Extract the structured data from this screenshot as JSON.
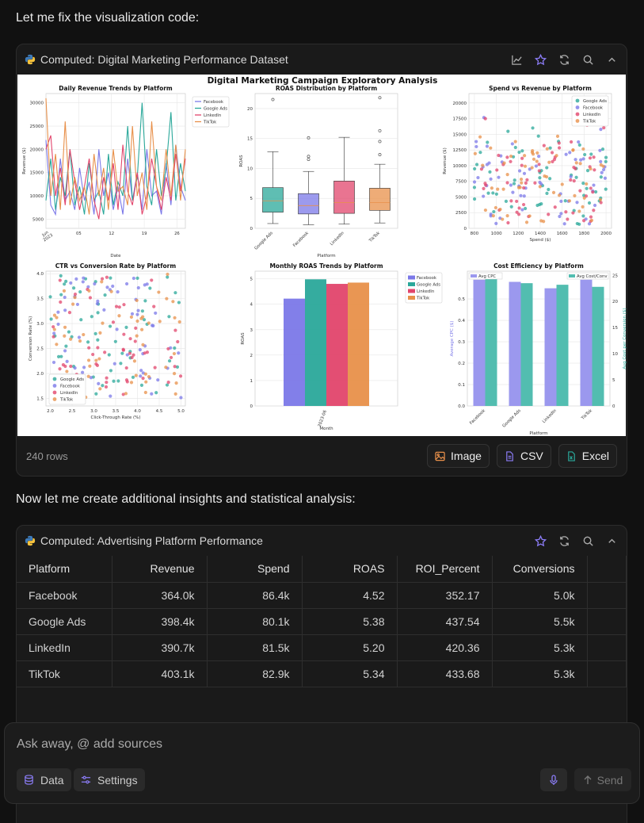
{
  "messages": {
    "first": "Let me fix the visualization code:",
    "second": "Now let me create additional insights and statistical analysis:"
  },
  "card1": {
    "title": "Computed: Digital Marketing Performance Dataset",
    "icons": [
      "line-chart-icon",
      "star-icon",
      "refresh-icon",
      "search-icon",
      "chevron-up-icon"
    ],
    "rows_label": "240 rows",
    "buttons": {
      "image": "Image",
      "csv": "CSV",
      "excel": "Excel"
    }
  },
  "figure": {
    "suptitle": "Digital Marketing Campaign Exploratory Analysis",
    "platforms": [
      "Facebook",
      "Google Ads",
      "LinkedIn",
      "TikTok"
    ],
    "colors": {
      "Facebook": "#7b78e8",
      "Google Ads": "#2aa89a",
      "LinkedIn": "#e2456c",
      "TikTok": "#e8904a"
    }
  },
  "chart_data": [
    {
      "type": "line",
      "title": "Daily Revenue Trends by Platform",
      "xlabel": "Date",
      "ylabel": "Revenue ($)",
      "xticks": [
        "Jun\n2023",
        "05",
        "12",
        "19",
        "26"
      ],
      "yticks": [
        "5000",
        "10000",
        "15000",
        "20000",
        "25000",
        "30000"
      ],
      "ylim": [
        3000,
        32000
      ],
      "legend": [
        "Facebook",
        "Google Ads",
        "LinkedIn",
        "TikTok"
      ],
      "series": [
        {
          "name": "Facebook",
          "values": [
            22000,
            8000,
            6000,
            18000,
            9000,
            11000,
            7000,
            16000,
            9000,
            13000,
            6000,
            20000,
            10000,
            15000,
            7000,
            12000,
            6000,
            18000,
            9000,
            15000,
            7000,
            20000,
            10000,
            11000,
            6000,
            17000,
            8000,
            21000,
            12000,
            9000
          ]
        },
        {
          "name": "Google Ads",
          "values": [
            9000,
            18000,
            7000,
            14000,
            10000,
            20000,
            8000,
            12000,
            6000,
            17000,
            9000,
            11000,
            6000,
            19000,
            8000,
            13000,
            10000,
            25000,
            9000,
            14000,
            30000,
            12000,
            8000,
            20000,
            10000,
            16000,
            28000,
            9000,
            17000,
            11000
          ]
        },
        {
          "name": "LinkedIn",
          "values": [
            20000,
            23000,
            10000,
            16000,
            8000,
            20000,
            13000,
            7000,
            12000,
            18000,
            9000,
            5000,
            14000,
            9000,
            17000,
            7000,
            21000,
            11000,
            8000,
            15000,
            6000,
            10000,
            18000,
            12000,
            7000,
            14000,
            9000,
            19000,
            11000,
            18000
          ]
        },
        {
          "name": "TikTok",
          "values": [
            31000,
            10000,
            19000,
            7000,
            26000,
            8000,
            14000,
            9000,
            12000,
            6000,
            19000,
            10000,
            16000,
            7000,
            20000,
            11000,
            12000,
            8000,
            25000,
            10000,
            15000,
            7000,
            26000,
            12000,
            9000,
            20000,
            10000,
            21000,
            9000,
            20000
          ]
        }
      ]
    },
    {
      "type": "box",
      "title": "ROAS Distribution by Platform",
      "xlabel": "Platform",
      "ylabel": "ROAS",
      "categories": [
        "Google Ads",
        "Facebook",
        "LinkedIn",
        "TikTok"
      ],
      "yticks": [
        "0",
        "5",
        "10",
        "15",
        "20"
      ],
      "ylim": [
        0,
        22.5
      ],
      "boxes": [
        {
          "name": "Google Ads",
          "min": 0.8,
          "q1": 2.7,
          "median": 4.6,
          "q3": 6.8,
          "max": 12.8,
          "outliers": [
            21.5
          ]
        },
        {
          "name": "Facebook",
          "min": 0.6,
          "q1": 2.4,
          "median": 3.8,
          "q3": 5.8,
          "max": 9.5,
          "outliers": [
            11.5,
            12.0,
            15.1
          ]
        },
        {
          "name": "LinkedIn",
          "min": 0.7,
          "q1": 2.5,
          "median": 4.3,
          "q3": 7.9,
          "max": 15.2,
          "outliers": []
        },
        {
          "name": "TikTok",
          "min": 0.9,
          "q1": 3.0,
          "median": 4.3,
          "q3": 6.7,
          "max": 10.7,
          "outliers": [
            12.3,
            14.5,
            16.3,
            21.8
          ]
        }
      ]
    },
    {
      "type": "scatter",
      "title": "Spend vs Revenue by Platform",
      "xlabel": "Spend ($)",
      "ylabel": "Revenue ($)",
      "xticks": [
        "800",
        "1000",
        "1200",
        "1400",
        "1600",
        "1800",
        "2000"
      ],
      "yticks": [
        "0",
        "2500",
        "5000",
        "7500",
        "10000",
        "12500",
        "15000",
        "17500",
        "20000"
      ],
      "xlim": [
        750,
        2050
      ],
      "ylim": [
        0,
        21500
      ],
      "legend": [
        "Google Ads",
        "Facebook",
        "LinkedIn",
        "TikTok"
      ],
      "points_per_series": 60
    },
    {
      "type": "scatter",
      "title": "CTR vs Conversion Rate by Platform",
      "xlabel": "Click-Through Rate (%)",
      "ylabel": "Conversion Rate (%)",
      "xticks": [
        "2.0",
        "2.5",
        "3.0",
        "3.5",
        "4.0",
        "4.5",
        "5.0"
      ],
      "yticks": [
        "1.5",
        "2.0",
        "2.5",
        "3.0",
        "3.5",
        "4.0"
      ],
      "xlim": [
        1.9,
        5.1
      ],
      "ylim": [
        1.35,
        4.05
      ],
      "legend": [
        "Google Ads",
        "Facebook",
        "LinkedIn",
        "TikTok"
      ],
      "points_per_series": 60
    },
    {
      "type": "bar",
      "title": "Monthly ROAS Trends by Platform",
      "xlabel": "Month",
      "ylabel": "ROAS",
      "categories": [
        "2023-06"
      ],
      "yticks": [
        "0",
        "1",
        "2",
        "3",
        "4",
        "5"
      ],
      "ylim": [
        0,
        5.3
      ],
      "series": [
        {
          "name": "Facebook",
          "values": [
            4.22
          ]
        },
        {
          "name": "Google Ads",
          "values": [
            4.98
          ]
        },
        {
          "name": "LinkedIn",
          "values": [
            4.8
          ]
        },
        {
          "name": "TikTok",
          "values": [
            4.85
          ]
        }
      ]
    },
    {
      "type": "bar",
      "title": "Cost Efficiency by Platform",
      "xlabel": "Platform",
      "ylabel": "Average CPC ($)",
      "ylabel2": "Avg Cost per Conversion ($)",
      "categories": [
        "Facebook",
        "Google Ads",
        "LinkedIn",
        "TikTok"
      ],
      "yticks": [
        "0.0",
        "0.1",
        "0.2",
        "0.3",
        "0.4",
        "0.5"
      ],
      "yticks2": [
        "0",
        "5",
        "10",
        "15",
        "20",
        "25"
      ],
      "ylim": [
        0,
        0.63
      ],
      "ylim2": [
        0,
        25.8
      ],
      "series": [
        {
          "name": "Avg CPC",
          "axis": "left",
          "values": [
            0.59,
            0.58,
            0.55,
            0.59
          ]
        },
        {
          "name": "Avg Cost/Conv",
          "axis": "right",
          "values": [
            24.8,
            23.5,
            23.2,
            22.8
          ]
        }
      ]
    }
  ],
  "card2": {
    "title": "Computed: Advertising Platform Performance",
    "icons": [
      "star-icon",
      "refresh-icon",
      "search-icon",
      "chevron-up-icon"
    ],
    "columns": [
      "Platform",
      "Revenue",
      "Spend",
      "ROAS",
      "ROI_Percent",
      "Conversions"
    ],
    "rows": [
      [
        "Facebook",
        "364.0k",
        "86.4k",
        "4.52",
        "352.17",
        "5.0k"
      ],
      [
        "Google Ads",
        "398.4k",
        "80.1k",
        "5.38",
        "437.54",
        "5.5k"
      ],
      [
        "LinkedIn",
        "390.7k",
        "81.5k",
        "5.20",
        "420.36",
        "5.3k"
      ],
      [
        "TikTok",
        "403.1k",
        "82.9k",
        "5.34",
        "433.68",
        "5.3k"
      ]
    ]
  },
  "composer": {
    "placeholder": "Ask away, @ add sources",
    "data_label": "Data",
    "settings_label": "Settings",
    "send_label": "Send"
  },
  "accent": "#8b7cf6"
}
